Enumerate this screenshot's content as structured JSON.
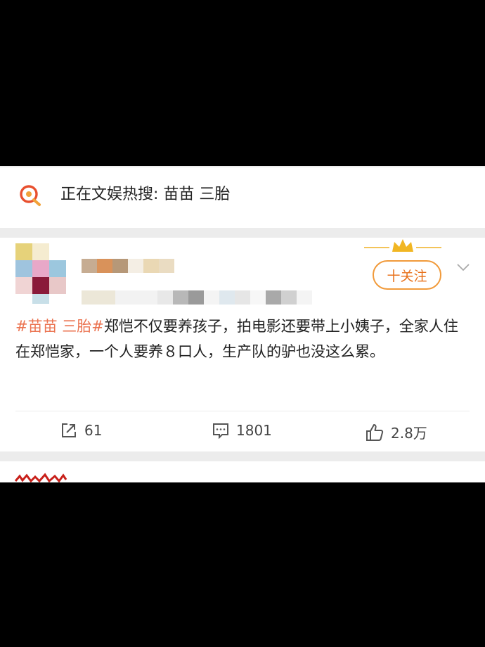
{
  "hot_search": {
    "label": "正在文娱热搜: 苗苗 三胎",
    "icon": "search-hot-icon"
  },
  "post": {
    "follow_label": "十关注",
    "hashtag": "#苗苗 三胎#",
    "body": "郑恺不仅要养孩子，拍电影还要带上小姨子，全家人住在郑恺家，一个人要养８口人，生产队的驴也没这么累。",
    "reposts": "61",
    "comments": "1801",
    "likes": "2.8万",
    "accent_color": "#eb7350",
    "follow_color": "#e8721c"
  }
}
